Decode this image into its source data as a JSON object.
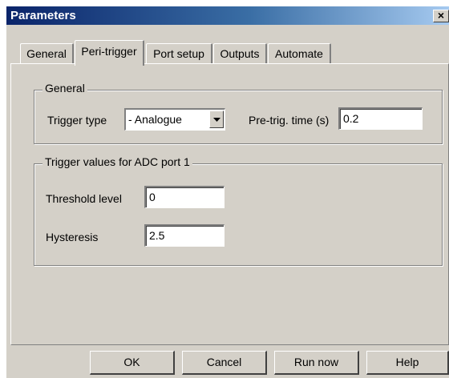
{
  "window": {
    "title": "Parameters",
    "close_label": "×"
  },
  "tabs": [
    {
      "label": "General",
      "active": false
    },
    {
      "label": "Peri-trigger",
      "active": true
    },
    {
      "label": "Port setup",
      "active": false
    },
    {
      "label": "Outputs",
      "active": false
    },
    {
      "label": "Automate",
      "active": false
    }
  ],
  "general_group": {
    "legend": "General",
    "trigger_type_label": "Trigger type",
    "trigger_type_value": "- Analogue",
    "pretrig_label": "Pre-trig. time (s)",
    "pretrig_value": "0.2"
  },
  "adc_group": {
    "legend": "Trigger values for ADC port 1",
    "threshold_label": "Threshold level",
    "threshold_value": "0",
    "hysteresis_label": "Hysteresis",
    "hysteresis_value": "2.5"
  },
  "buttons": {
    "ok": "OK",
    "cancel": "Cancel",
    "run_now": "Run now",
    "help": "Help"
  }
}
